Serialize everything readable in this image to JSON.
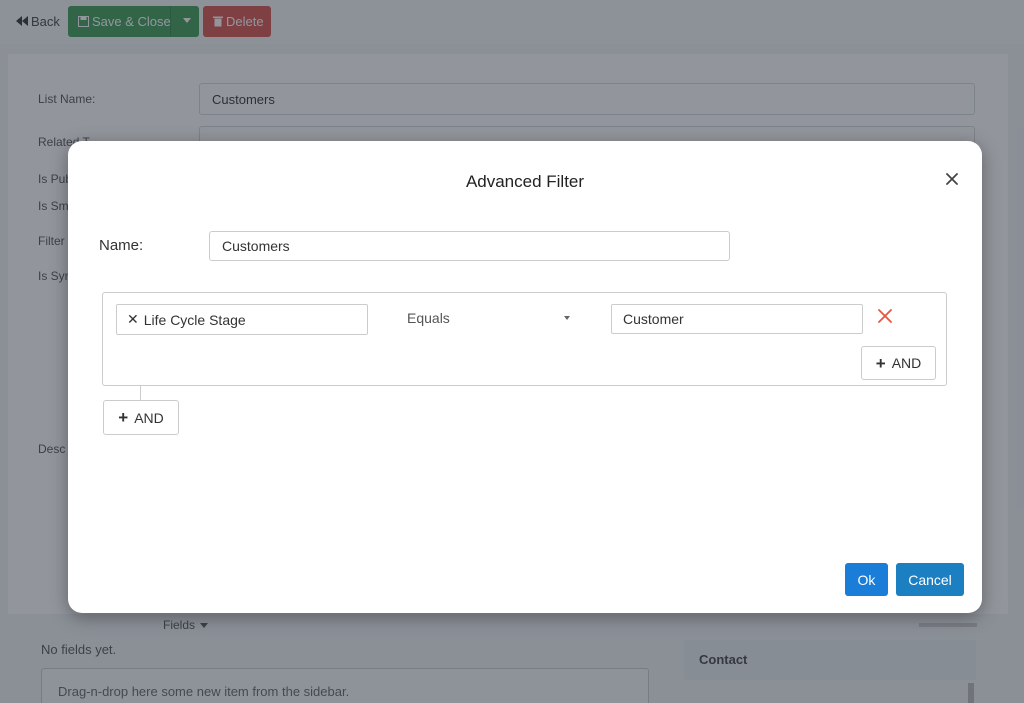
{
  "toolbar": {
    "back_label": "Back",
    "save_label": "Save & Close",
    "delete_label": "Delete"
  },
  "form": {
    "list_name_label": "List Name:",
    "list_name_value": "Customers",
    "related_to_label": "Related T",
    "is_public_label": "Is Pub",
    "is_smart_label": "Is Sm",
    "filter_label": "Filter",
    "is_sync_label": "Is Syn",
    "description_label": "Desc"
  },
  "fields_panel": {
    "header": "Fields",
    "empty_text": "No fields yet.",
    "dropzone_text": "Drag-n-drop here some new item from the sidebar.",
    "contact_label": "Contact"
  },
  "modal": {
    "title": "Advanced Filter",
    "name_label": "Name:",
    "name_value": "Customers",
    "condition": {
      "field": "Life Cycle Stage",
      "operator": "Equals",
      "value": "Customer"
    },
    "and_inner_label": "AND",
    "and_outer_label": "AND",
    "ok_label": "Ok",
    "cancel_label": "Cancel"
  },
  "colors": {
    "save_button": "#3f9b57",
    "delete_button": "#d9534f",
    "ok_button": "#1a7dd7",
    "cancel_button": "#1c7fc2",
    "remove_icon": "#e8543f"
  }
}
